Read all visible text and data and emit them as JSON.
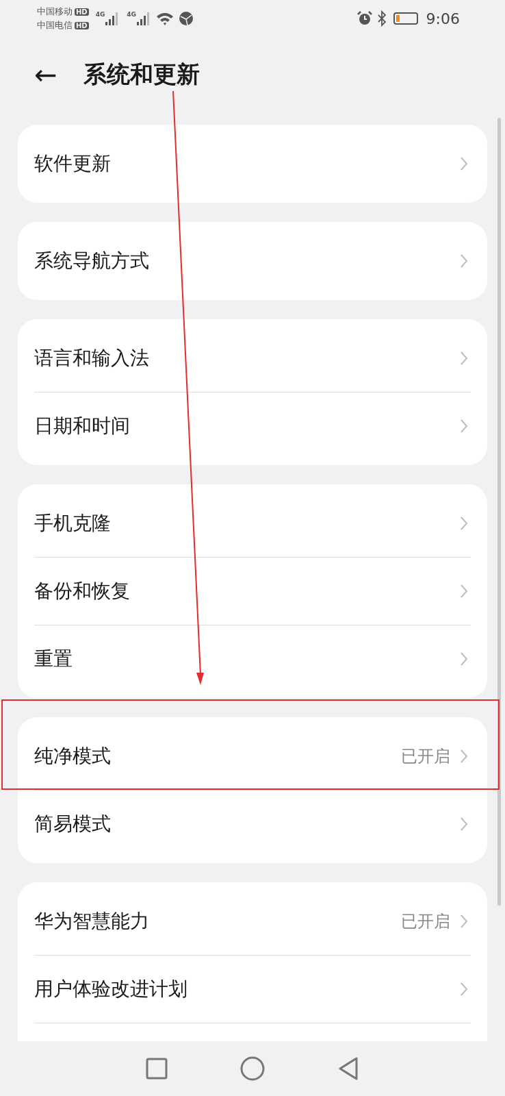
{
  "status_bar": {
    "carriers": [
      {
        "name": "中国移动",
        "badge": "HD"
      },
      {
        "name": "中国电信",
        "badge": "HD"
      }
    ],
    "networks": [
      "4G",
      "4G"
    ],
    "battery": {
      "level": 0.2
    },
    "time": "9:06"
  },
  "header": {
    "back": "←",
    "title": "系统和更新"
  },
  "groups": [
    {
      "rows": [
        {
          "label": "软件更新"
        }
      ]
    },
    {
      "rows": [
        {
          "label": "系统导航方式"
        }
      ]
    },
    {
      "rows": [
        {
          "label": "语言和输入法"
        },
        {
          "label": "日期和时间"
        }
      ]
    },
    {
      "rows": [
        {
          "label": "手机克隆"
        },
        {
          "label": "备份和恢复"
        },
        {
          "label": "重置"
        }
      ]
    },
    {
      "rows": [
        {
          "label": "纯净模式",
          "value": "已开启"
        },
        {
          "label": "简易模式"
        }
      ]
    },
    {
      "rows": [
        {
          "label": "华为智慧能力",
          "value": "已开启"
        },
        {
          "label": "用户体验改进计划"
        }
      ]
    }
  ]
}
